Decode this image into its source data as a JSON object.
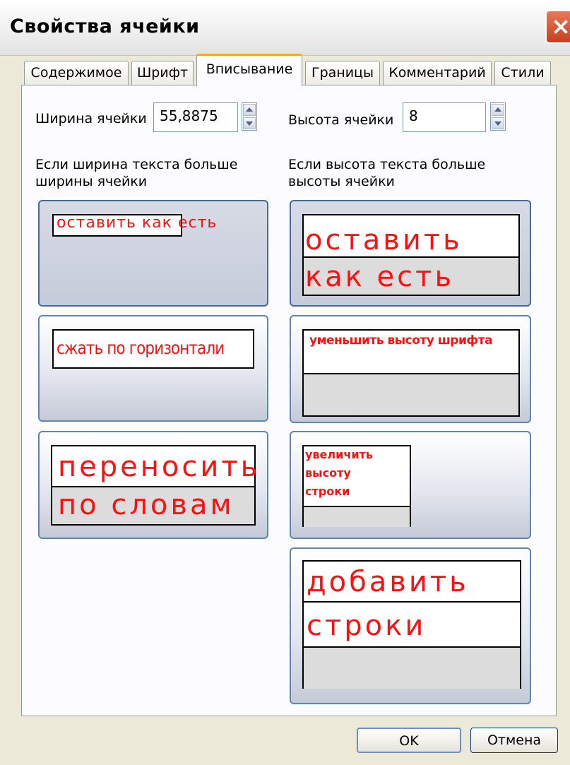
{
  "window": {
    "title": "Свойства ячейки"
  },
  "tabs": [
    {
      "label": "Содержимое",
      "active": false
    },
    {
      "label": "Шрифт",
      "active": false
    },
    {
      "label": "Вписывание",
      "active": true
    },
    {
      "label": "Границы",
      "active": false
    },
    {
      "label": "Комментарий",
      "active": false
    },
    {
      "label": "Стили",
      "active": false
    }
  ],
  "fields": {
    "width_label": "Ширина ячейки",
    "width_value": "55,8875",
    "height_label": "Высота ячейки",
    "height_value": "8"
  },
  "width_section": {
    "caption_line1": "Если ширина текста больше",
    "caption_line2": "ширины ячейки",
    "options": [
      {
        "text": "оставить как есть",
        "selected": true
      },
      {
        "text": "сжать по горизонтали",
        "selected": false
      },
      {
        "line1": "переносить",
        "line2": "по словам",
        "selected": false
      }
    ]
  },
  "height_section": {
    "caption_line1": "Если высота текста больше",
    "caption_line2": "высоты ячейки",
    "options": [
      {
        "line1": "оставить",
        "line2": "как есть",
        "selected": true
      },
      {
        "text": "уменьшить высоту шрифта",
        "selected": false
      },
      {
        "line1": "увеличить",
        "line2": "высоту",
        "line3": "строки",
        "selected": false
      },
      {
        "line1": "добавить",
        "line2": "строки",
        "selected": false
      }
    ]
  },
  "buttons": {
    "ok": "OK",
    "cancel": "Отмена"
  },
  "colors": {
    "accent_text": "#ff1010",
    "tab_highlight": "#f7a81b",
    "option_border": "#5c86b7"
  }
}
